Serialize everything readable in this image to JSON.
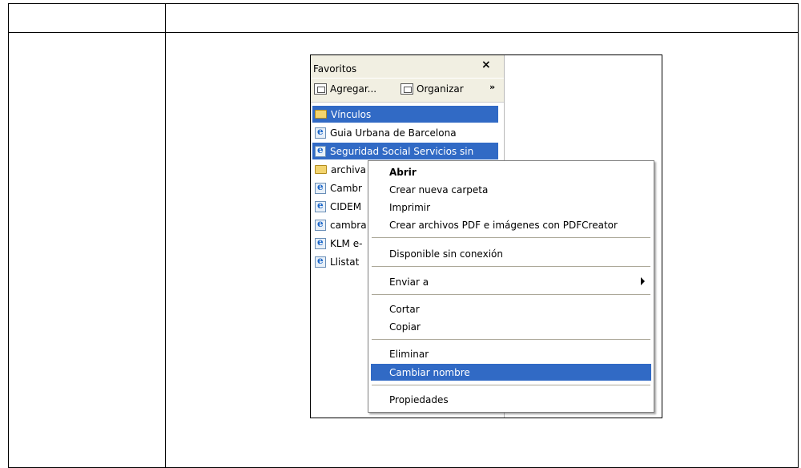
{
  "favorites": {
    "title": "Favoritos",
    "close_label": "×",
    "toolbar": {
      "add_label": "Agregar...",
      "organize_label": "Organizar",
      "more_label": "»"
    },
    "items": [
      {
        "label": "Vínculos",
        "icon": "folder-icon",
        "selected": true
      },
      {
        "label": "Guia Urbana de Barcelona",
        "icon": "ie-page-icon"
      },
      {
        "label": "Seguridad Social Servicios sin",
        "icon": "ie-page-icon",
        "selected": true
      },
      {
        "label": "archiva",
        "icon": "folder-icon"
      },
      {
        "label": "Cambr",
        "icon": "ie-page-icon"
      },
      {
        "label": "CIDEM",
        "icon": "ie-page-icon"
      },
      {
        "label": "cambra",
        "icon": "ie-page-icon"
      },
      {
        "label": "KLM e-",
        "icon": "ie-page-icon"
      },
      {
        "label": "Llistat",
        "icon": "ie-page-icon"
      }
    ]
  },
  "context_menu": {
    "items": [
      {
        "label": "Abrir",
        "bold": true
      },
      {
        "label": "Crear nueva carpeta"
      },
      {
        "label": "Imprimir"
      },
      {
        "label": "Crear archivos PDF e imágenes con PDFCreator"
      },
      {
        "label": "Disponible sin conexión"
      },
      {
        "label": "Enviar a",
        "submenu": true
      },
      {
        "label": "Cortar"
      },
      {
        "label": "Copiar"
      },
      {
        "label": "Eliminar"
      },
      {
        "label": "Cambiar nombre",
        "highlighted": true
      },
      {
        "label": "Propiedades"
      }
    ]
  },
  "colors": {
    "selection": "#316ac5",
    "panel": "#f1efe2"
  }
}
